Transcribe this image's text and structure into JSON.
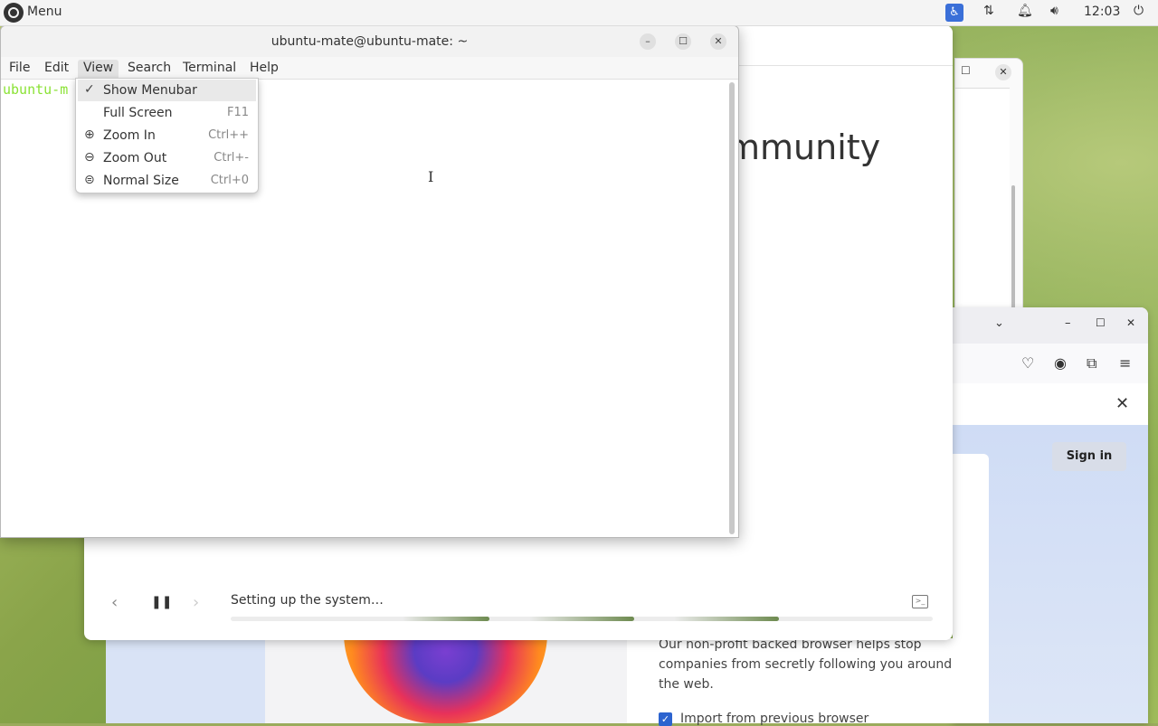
{
  "top_panel": {
    "menu_label": "Menu",
    "clock": "12:03"
  },
  "terminal": {
    "title": "ubuntu-mate@ubuntu-mate: ~",
    "menus": [
      "File",
      "Edit",
      "View",
      "Search",
      "Terminal",
      "Help"
    ],
    "prompt_visible": "ubuntu-m"
  },
  "view_menu": {
    "items": [
      {
        "label": "Show Menubar",
        "shortcut": "",
        "icon": "check-icon"
      },
      {
        "label": "Full Screen",
        "shortcut": "F11",
        "icon": ""
      },
      {
        "label": "Zoom In",
        "shortcut": "Ctrl++",
        "icon": "zoom-in-icon"
      },
      {
        "label": "Zoom Out",
        "shortcut": "Ctrl+-",
        "icon": "zoom-out-icon"
      },
      {
        "label": "Normal Size",
        "shortcut": "Ctrl+0",
        "icon": "zoom-reset-icon"
      }
    ]
  },
  "installer": {
    "heading_fragment": "mmunity",
    "status": "Setting up the system…",
    "progress": 0.79
  },
  "firefox": {
    "sign_in": "Sign in",
    "body_text": "Our non-profit backed browser helps stop companies from secretly following you around the web.",
    "import_label": "Import from previous browser"
  },
  "colors": {
    "accent_blue": "#2c63cf",
    "prompt_green": "#8ae234",
    "progress_green": "#6d8a4f"
  }
}
